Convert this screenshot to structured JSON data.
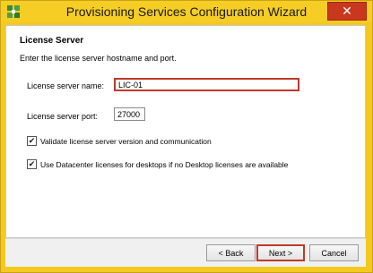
{
  "window": {
    "title": "Provisioning Services Configuration Wizard",
    "close_label": "✕"
  },
  "page": {
    "heading": "License Server",
    "description": "Enter the license server hostname and port."
  },
  "fields": {
    "server_name_label": "License server name:",
    "server_name_value": "LIC-01",
    "server_port_label": "License server port:",
    "server_port_value": "27000"
  },
  "options": {
    "validate_label": "Validate license server version and communication",
    "validate_checked": true,
    "datacenter_label": "Use Datacenter licenses for desktops if no Desktop licenses are available",
    "datacenter_checked": true,
    "check_glyph": "✔"
  },
  "buttons": {
    "back": "< Back",
    "next": "Next >",
    "cancel": "Cancel"
  },
  "colors": {
    "title_bar": "#f5cd25",
    "close_button": "#c7381f",
    "highlight": "#c0392b"
  }
}
